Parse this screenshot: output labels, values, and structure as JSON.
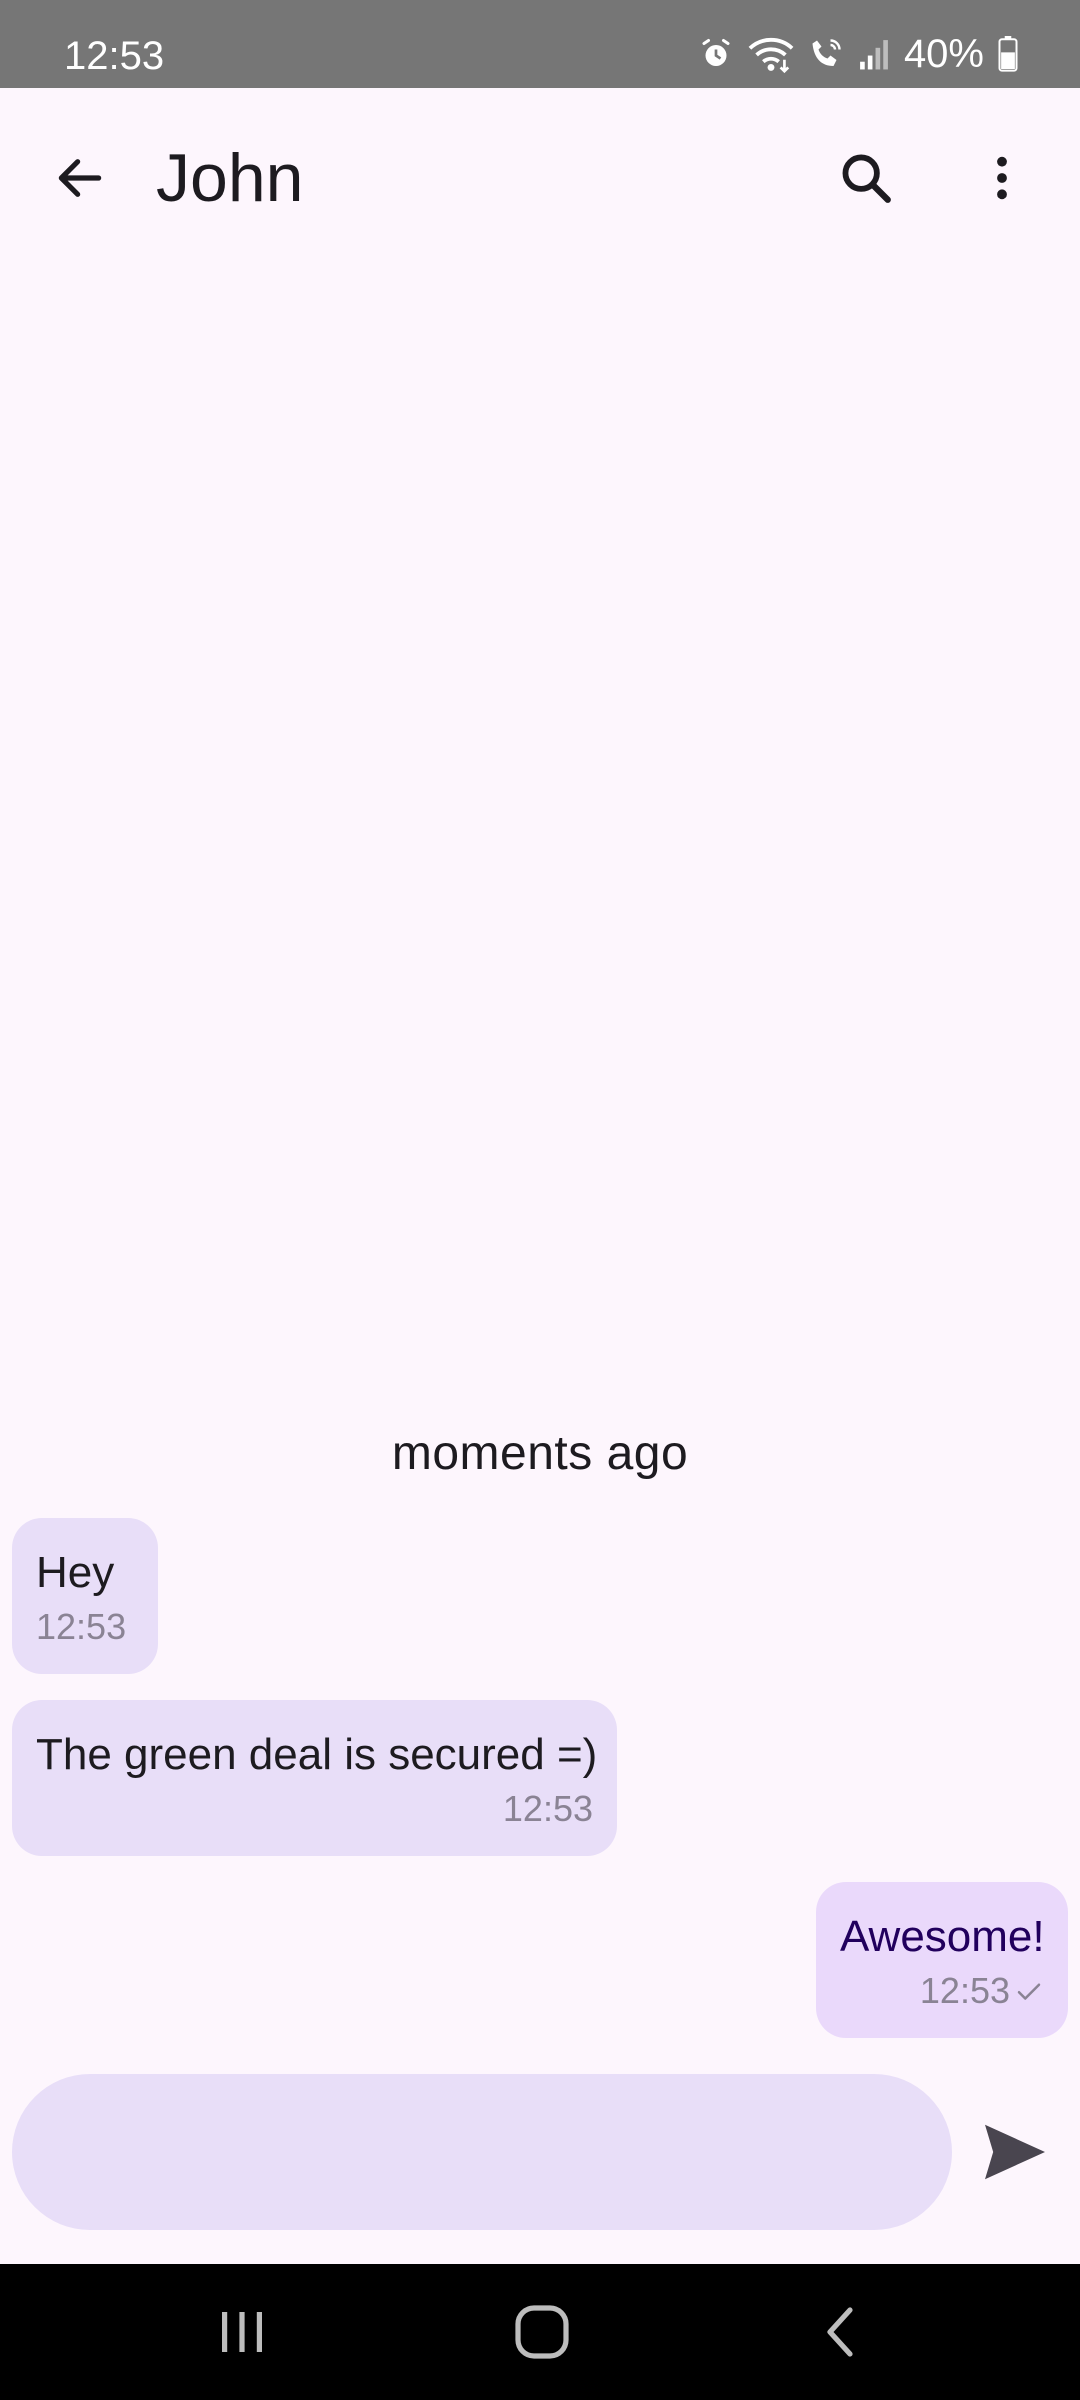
{
  "status_bar": {
    "time": "12:53",
    "battery_percent": "40%",
    "icons": [
      "alarm-icon",
      "wifi-icon",
      "wifi-calling-icon",
      "signal-icon",
      "battery-icon"
    ]
  },
  "app_bar": {
    "title": "John",
    "icons": [
      "back-arrow-icon",
      "search-icon",
      "more-vert-icon"
    ]
  },
  "conversation": {
    "day_label": "moments ago",
    "messages": [
      {
        "direction": "incoming",
        "text": "Hey",
        "time": "12:53"
      },
      {
        "direction": "incoming",
        "text": "The green deal is secured =)",
        "time": "12:53"
      },
      {
        "direction": "outgoing",
        "text": "Awesome!",
        "time": "12:53",
        "status": "sent"
      }
    ]
  },
  "composer": {
    "value": "",
    "placeholder": ""
  },
  "colors": {
    "background": "#fdf6fd",
    "incoming_bubble": "#e8def8",
    "outgoing_bubble": "#ead9fb",
    "status_bar": "#767676",
    "nav_bar": "#000000"
  }
}
